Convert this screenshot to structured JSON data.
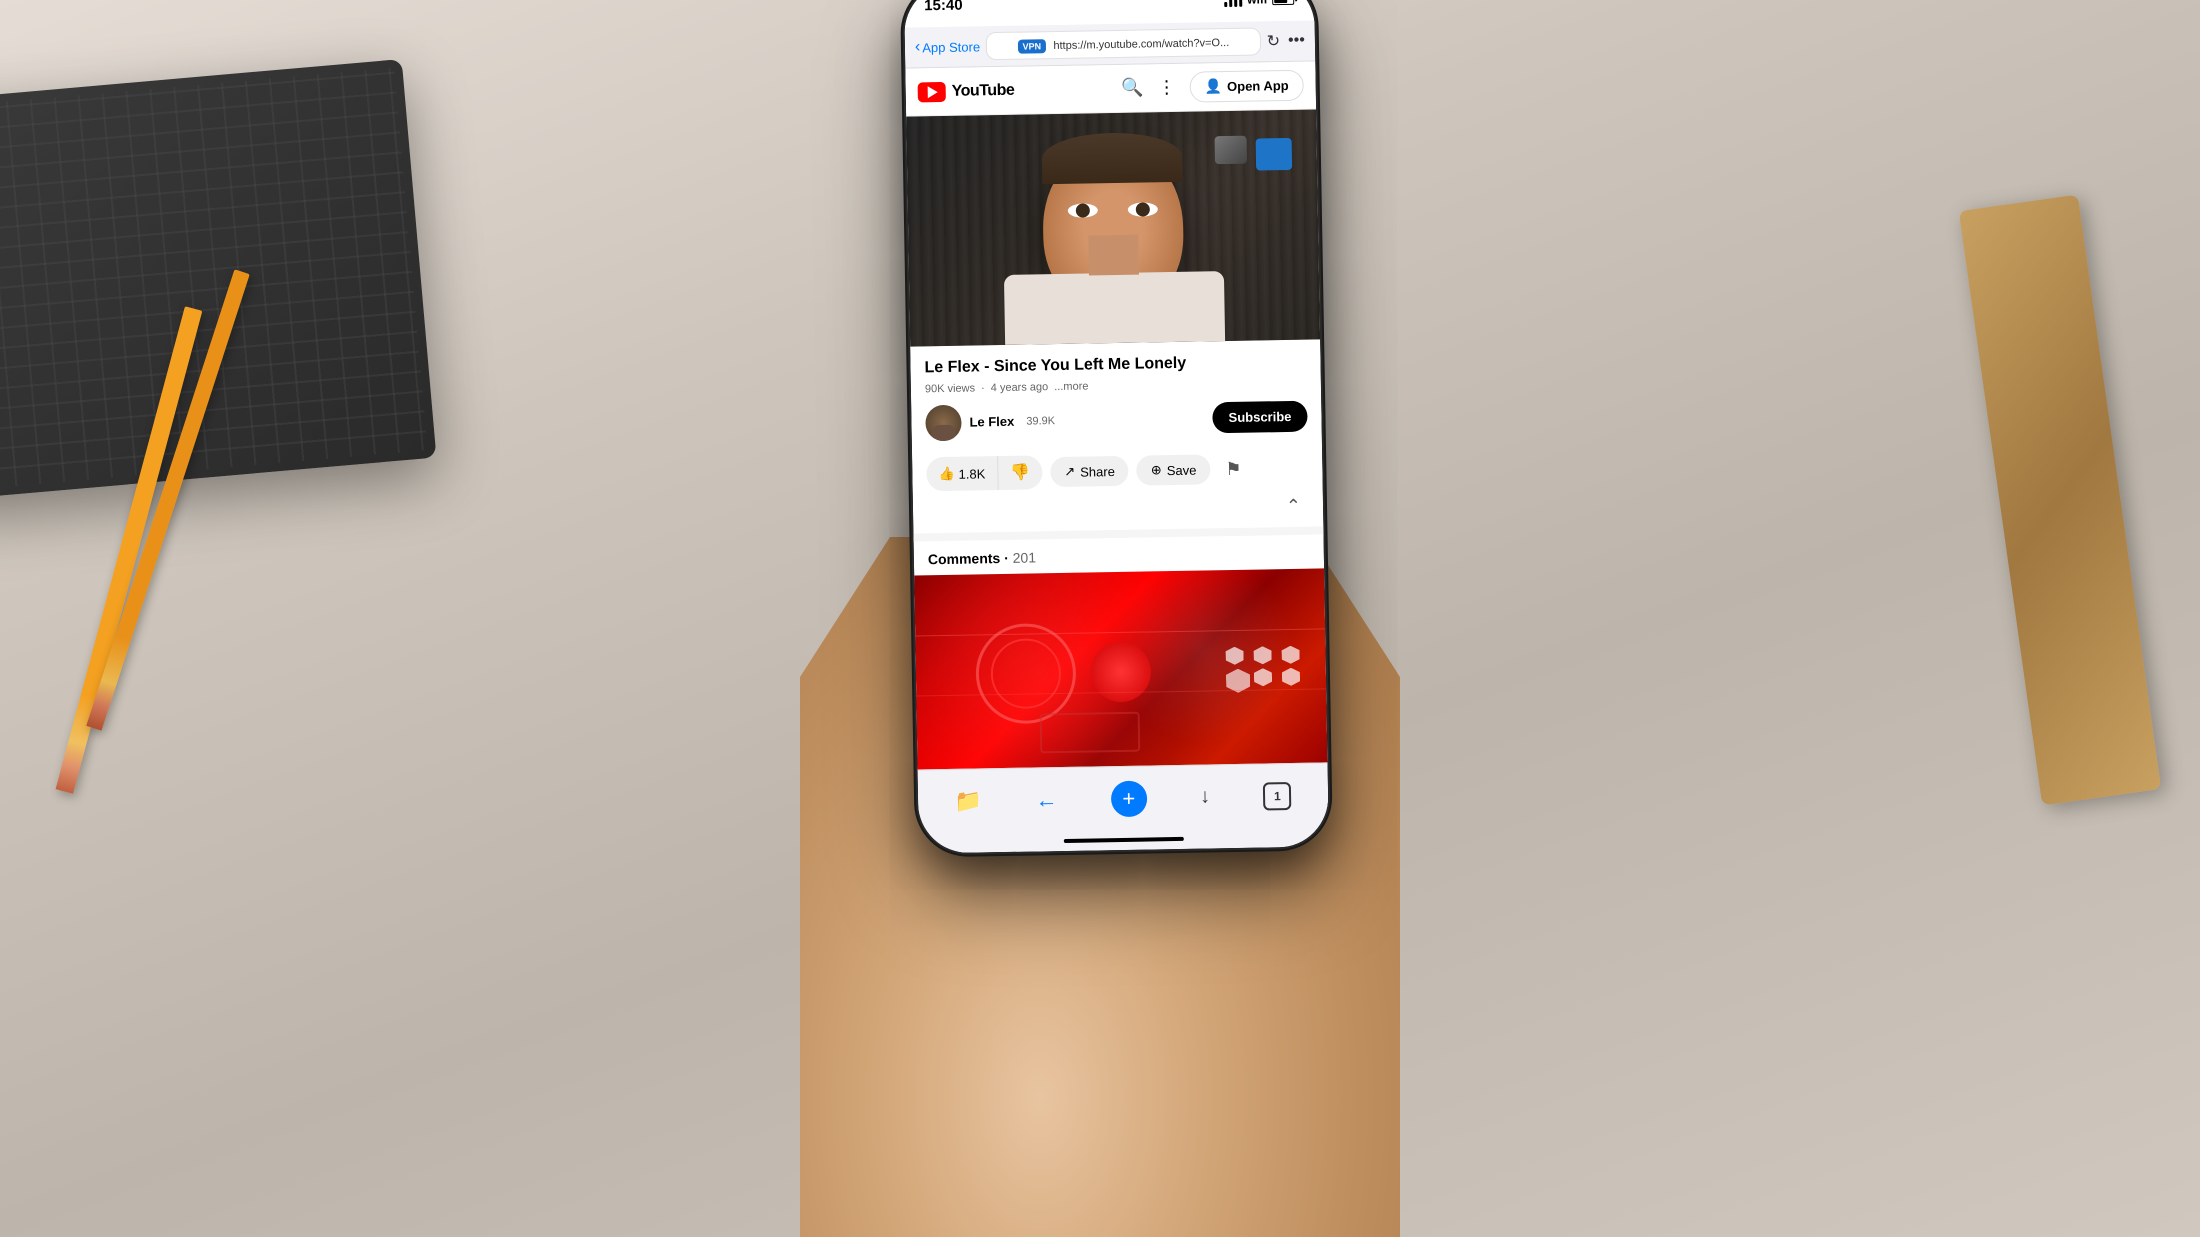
{
  "scene": {
    "background": "#d8cfc4"
  },
  "phone": {
    "status_bar": {
      "time": "15:40",
      "vpn_label": "VPN",
      "signal_bars": 4,
      "wifi": true,
      "battery_pct": 70
    },
    "browser": {
      "back_label": "App Store",
      "url": "https://m.youtube.com/watch?v=O...",
      "reload_icon": "↻",
      "more_icon": "•••",
      "open_app_label": "Open App"
    },
    "youtube": {
      "logo_text": "YouTube",
      "search_icon": "search",
      "menu_icon": "⋮",
      "video": {
        "title": "Le Flex - Since You Left Me Lonely",
        "views": "90K views",
        "age": "4 years ago",
        "more_label": "...more",
        "channel_name": "Le Flex",
        "channel_subs": "39.9K",
        "subscribe_label": "Subscribe",
        "likes": "1.8K",
        "share_label": "Share",
        "save_label": "Save"
      },
      "comments": {
        "label": "Comments",
        "count": "201"
      },
      "toolbar": {
        "back_label": "←",
        "plus_label": "+",
        "download_label": "↓",
        "tabs_label": "1",
        "files_icon": "📁"
      }
    }
  }
}
